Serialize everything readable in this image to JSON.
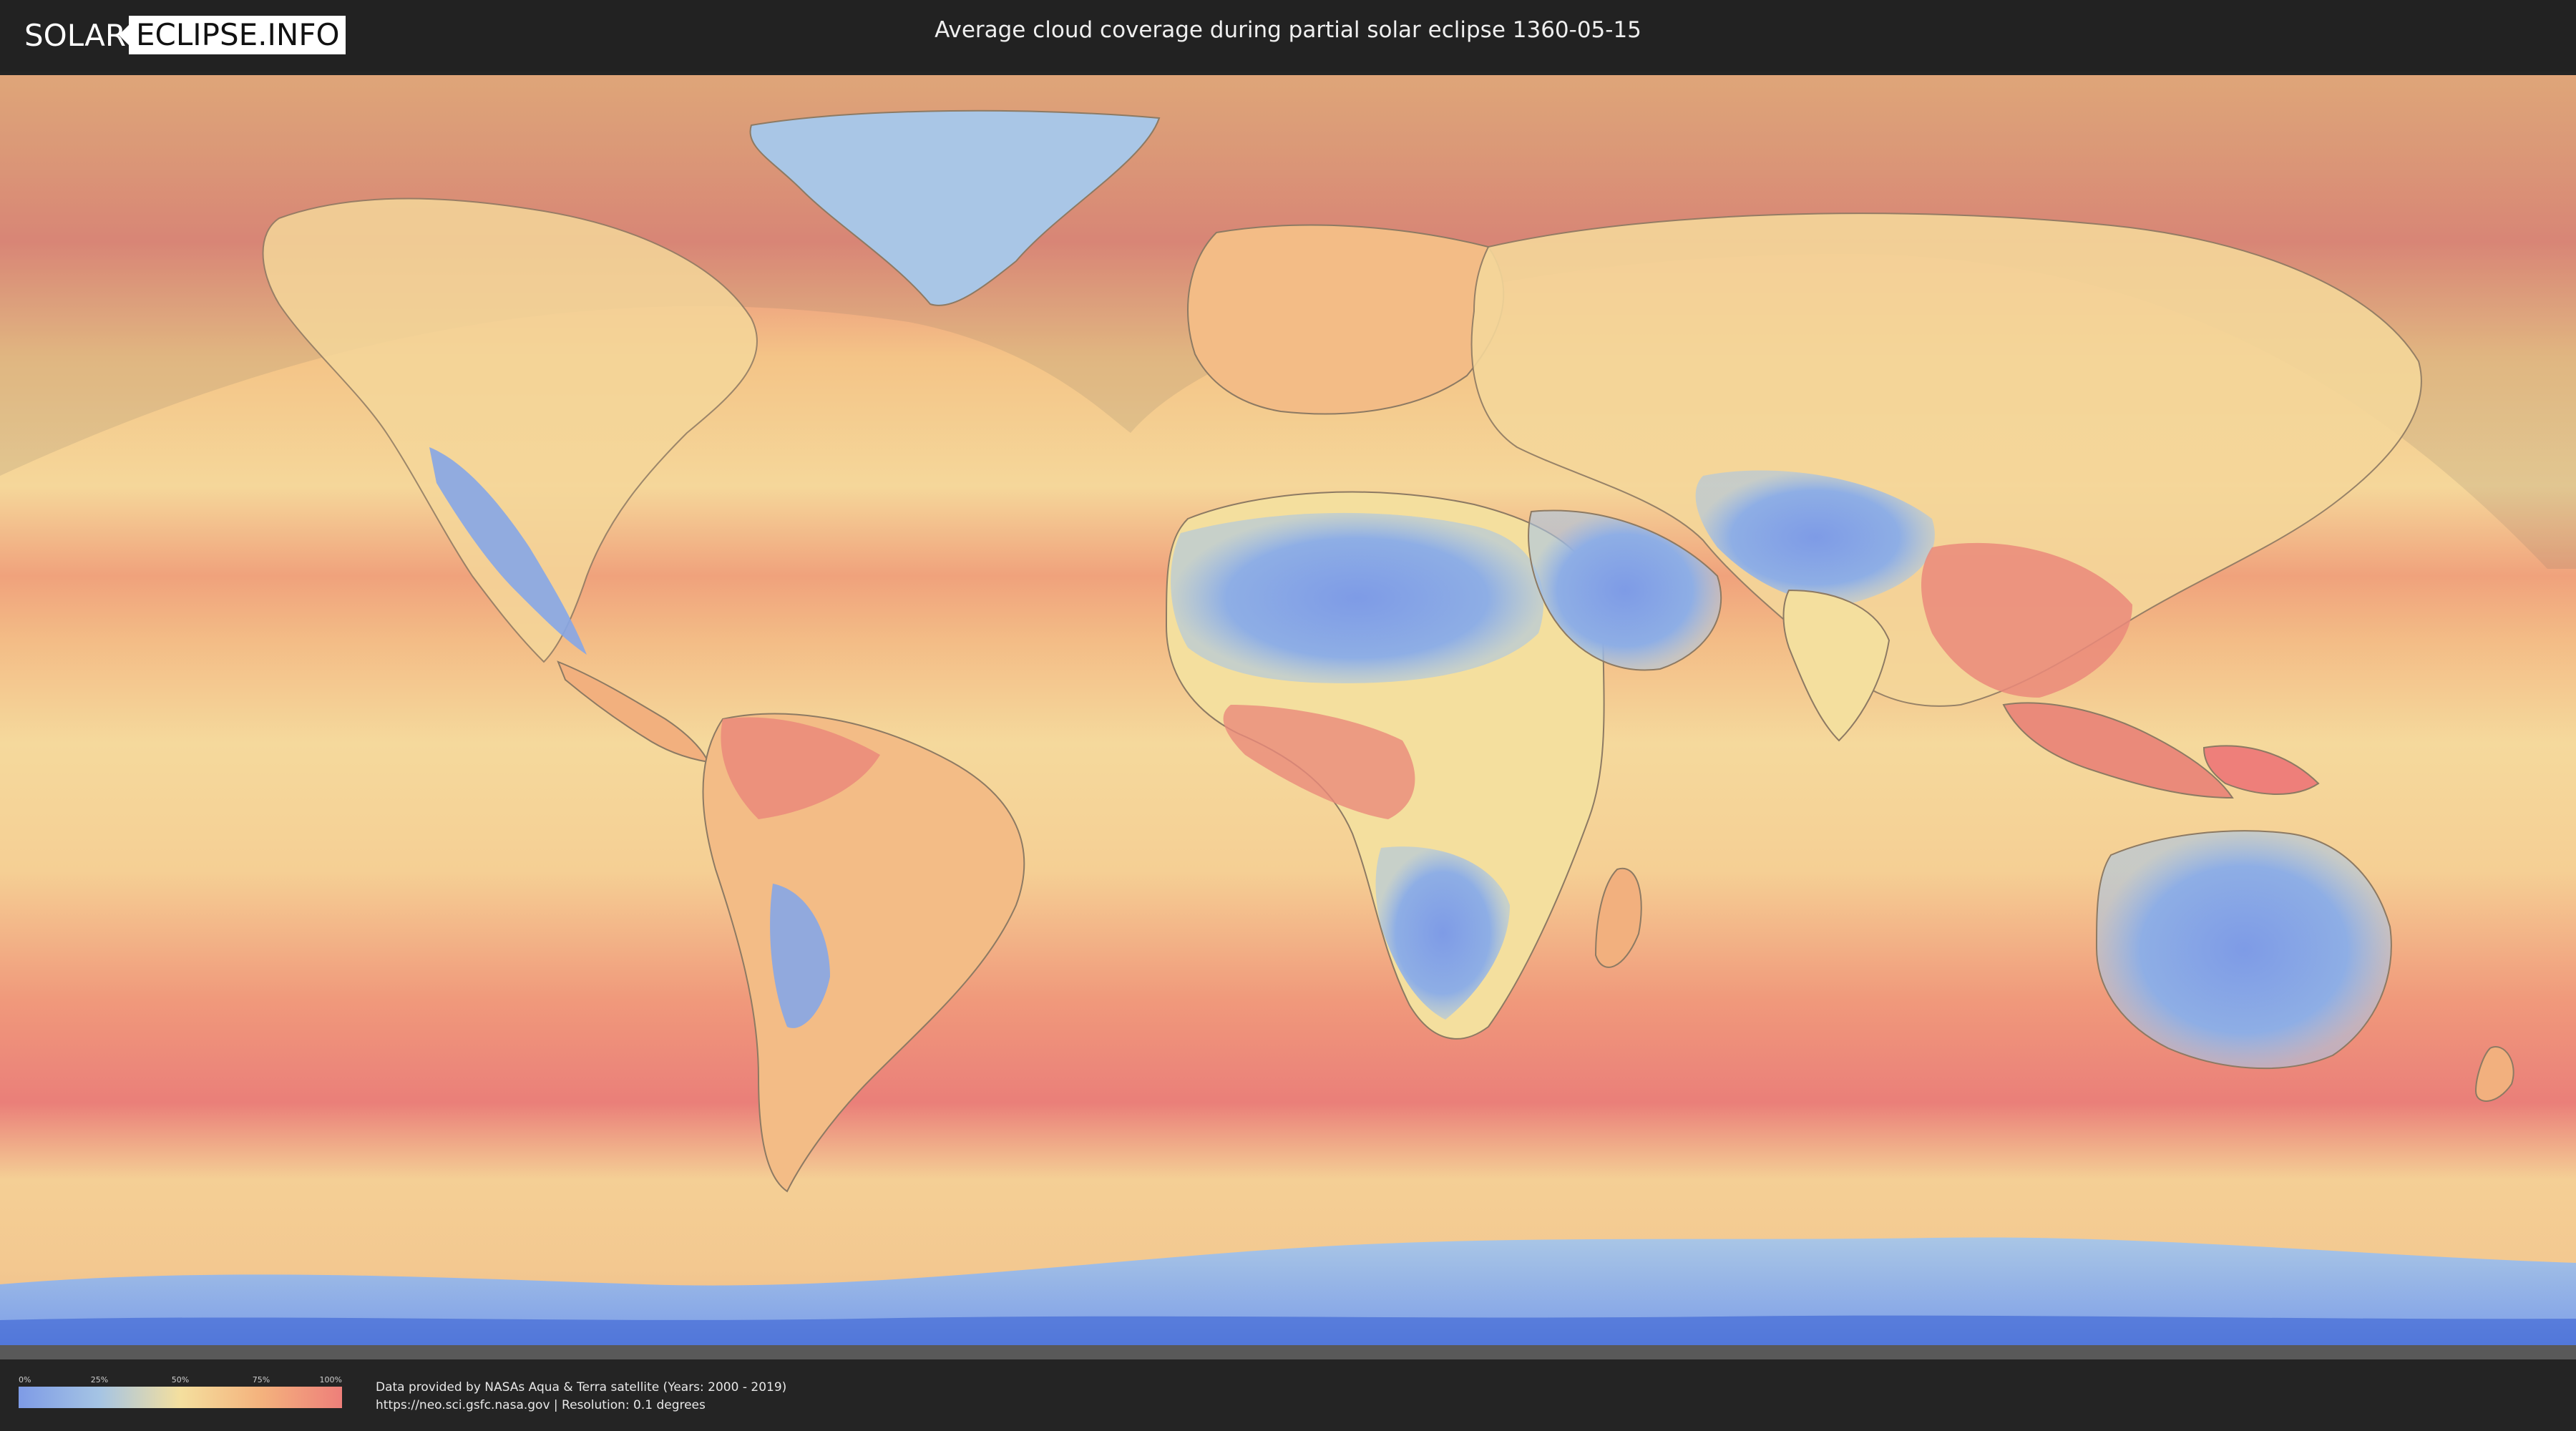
{
  "header": {
    "logo_left": "SOLAR",
    "logo_right": "ECLIPSE.INFO",
    "title": "Average cloud coverage during partial solar eclipse 1360-05-15"
  },
  "map": {
    "palette": {
      "clear": "#7e9be6",
      "low": "#a5c4e4",
      "mid": "#f4df9e",
      "high": "#f4b27d",
      "overcast": "#ee7f7a",
      "deep_clear": "#4f74d8",
      "eclipse_shade": "#8a7f70"
    },
    "coastline_color": "#8d7a63"
  },
  "legend": {
    "ticks": [
      "0%",
      "25%",
      "50%",
      "75%",
      "100%"
    ]
  },
  "credits": {
    "line1": "Data provided by NASAs Aqua & Terra satellite (Years: 2000 - 2019)",
    "line2": "https://neo.sci.gsfc.nasa.gov | Resolution: 0.1 degrees"
  }
}
